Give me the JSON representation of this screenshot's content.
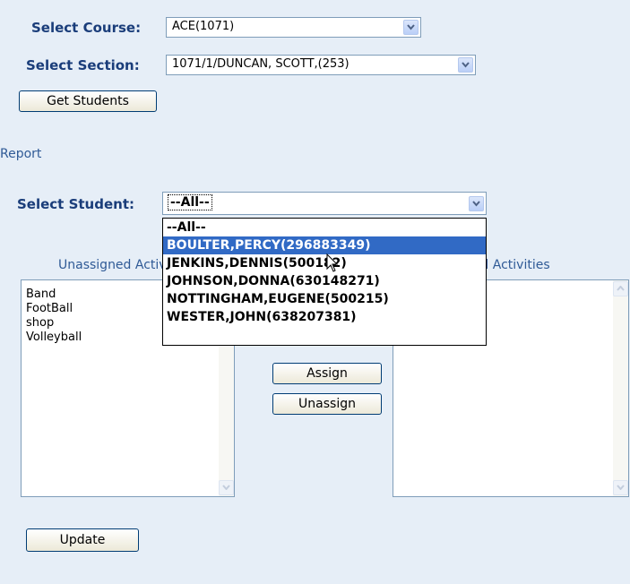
{
  "course": {
    "label": "Select Course:",
    "value": "ACE(1071)"
  },
  "section": {
    "label": "Select Section:",
    "value": "1071/1/DUNCAN, SCOTT,(253)"
  },
  "get_students_label": "Get Students",
  "report_label": "Report",
  "student": {
    "label": "Select Student:",
    "value": "--All--"
  },
  "student_options": [
    "--All--",
    "BOULTER,PERCY(296883349)",
    "JENKINS,DENNIS(500182)",
    "JOHNSON,DONNA(630148271)",
    "NOTTINGHAM,EUGENE(500215)",
    "WESTER,JOHN(638207381)"
  ],
  "highlighted_option_index": 1,
  "unassigned": {
    "label": "Unassigned Activities",
    "items": [
      "Band",
      "FootBall",
      "shop",
      "Volleyball"
    ]
  },
  "assigned": {
    "label": "Assigned Activities",
    "items": []
  },
  "assign_label": "Assign",
  "unassign_label": "Unassign",
  "update_label": "Update",
  "icons": {
    "dropdown": "chevron-down-icon",
    "scroll_up": "scroll-up-icon",
    "scroll_down": "scroll-down-icon",
    "cursor": "mouse-pointer-icon"
  },
  "colors": {
    "background": "#e6eef7",
    "label": "#1a3d7a",
    "highlight": "#316ac5"
  }
}
